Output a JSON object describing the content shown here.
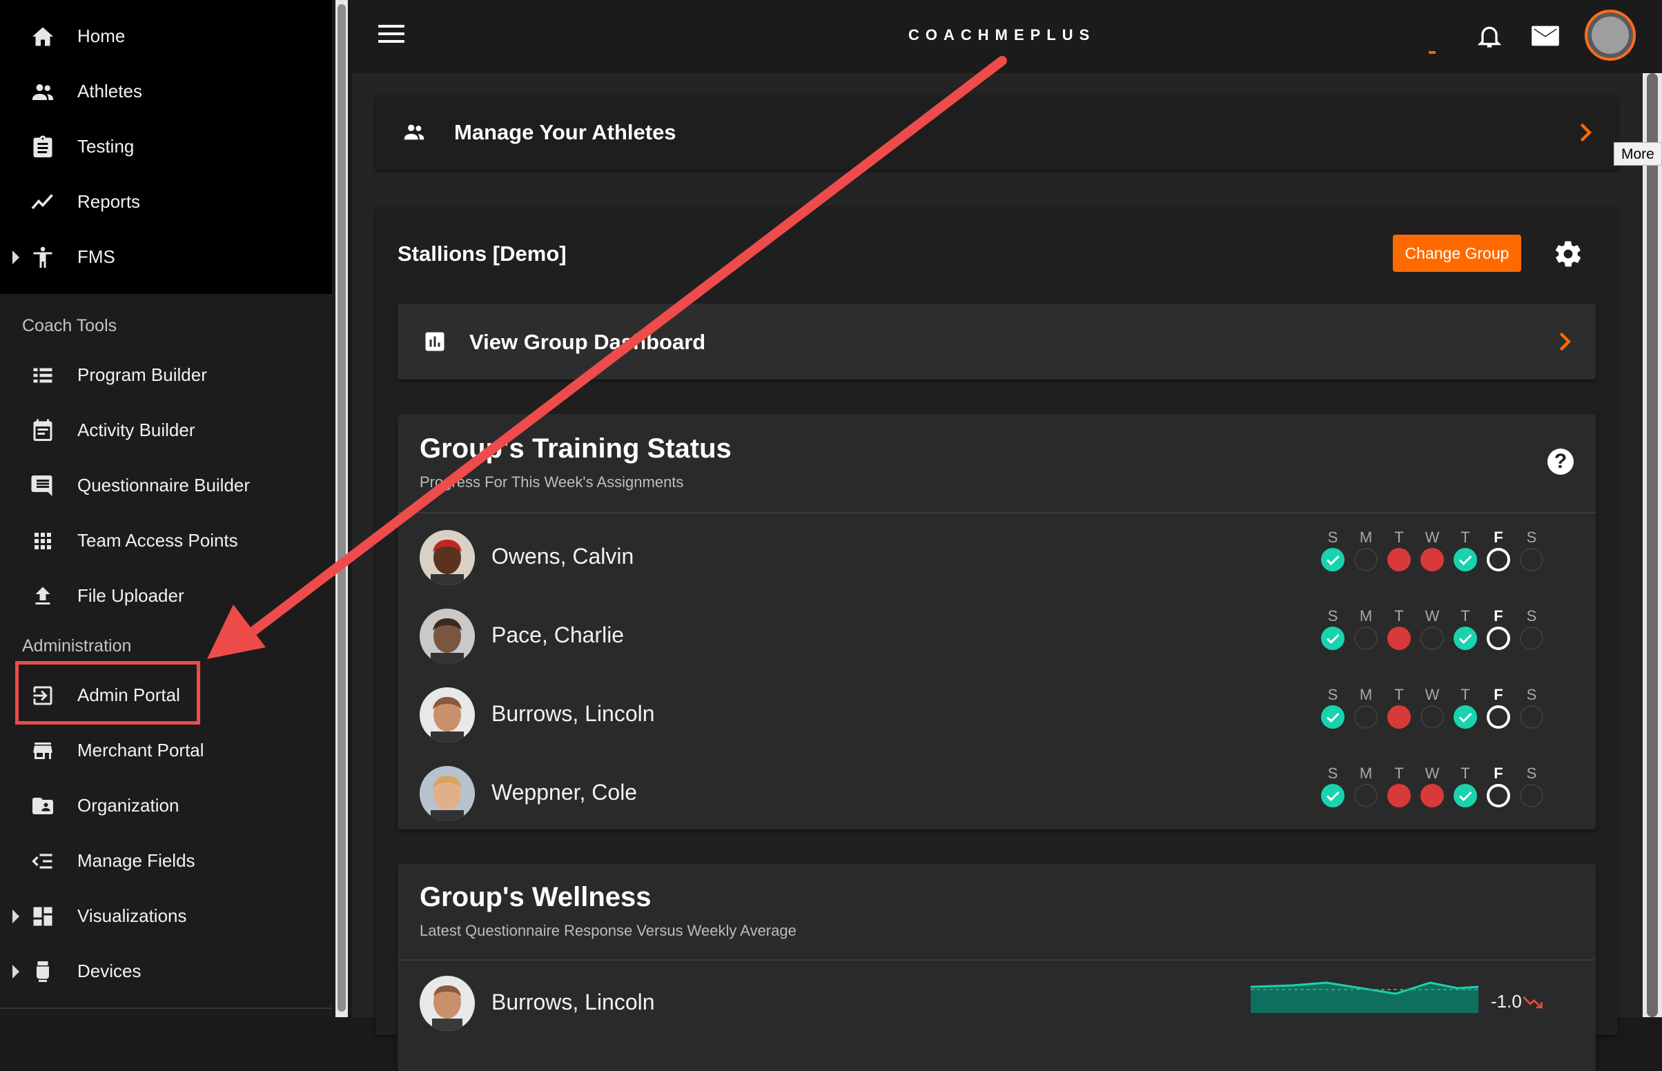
{
  "sidebar": {
    "primary_items": [
      {
        "label": "Home",
        "icon": "home-icon"
      },
      {
        "label": "Athletes",
        "icon": "athletes-icon"
      },
      {
        "label": "Testing",
        "icon": "clipboard-icon"
      },
      {
        "label": "Reports",
        "icon": "trend-line-icon"
      },
      {
        "label": "FMS",
        "icon": "figure-icon"
      }
    ],
    "coach_tools_label": "Coach Tools",
    "coach_tools": [
      {
        "label": "Program Builder"
      },
      {
        "label": "Activity Builder"
      },
      {
        "label": "Questionnaire Builder"
      },
      {
        "label": "Team Access Points"
      },
      {
        "label": "File Uploader"
      }
    ],
    "administration_label": "Administration",
    "administration": [
      {
        "label": "Admin Portal"
      },
      {
        "label": "Merchant Portal"
      },
      {
        "label": "Organization"
      },
      {
        "label": "Manage Fields"
      },
      {
        "label": "Visualizations"
      },
      {
        "label": "Devices"
      }
    ]
  },
  "topbar": {
    "logo": "COACHMEPLUS",
    "more_tooltip": "More"
  },
  "manage": {
    "title": "Manage Your Athletes"
  },
  "group": {
    "name": "Stallions [Demo]",
    "change_group_label": "Change Group",
    "dashboard_label": "View Group Dashboard"
  },
  "training_status": {
    "title": "Group's Training Status",
    "subtitle": "Progress For This Week's Assignments",
    "days": [
      "S",
      "M",
      "T",
      "W",
      "T",
      "F",
      "S"
    ],
    "today_index": 5,
    "athletes": [
      {
        "name": "Owens, Calvin",
        "status": [
          "done",
          "none",
          "missed",
          "missed",
          "done",
          "today",
          "none"
        ]
      },
      {
        "name": "Pace, Charlie",
        "status": [
          "done",
          "none",
          "missed",
          "none",
          "done",
          "today",
          "none"
        ]
      },
      {
        "name": "Burrows, Lincoln",
        "status": [
          "done",
          "none",
          "missed",
          "none",
          "done",
          "today",
          "none"
        ]
      },
      {
        "name": "Weppner, Cole",
        "status": [
          "done",
          "none",
          "missed",
          "missed",
          "done",
          "today",
          "none"
        ]
      }
    ]
  },
  "wellness": {
    "title": "Group's Wellness",
    "subtitle": "Latest Questionnaire Response Versus Weekly Average",
    "rows": [
      {
        "name": "Burrows, Lincoln",
        "value": "-1.0",
        "trend": "down"
      }
    ]
  },
  "colors": {
    "accent_orange": "#ff6a00",
    "done_teal": "#19d3ae",
    "missed_red": "#d83a3a",
    "annotation_red": "#ee4b4b"
  }
}
